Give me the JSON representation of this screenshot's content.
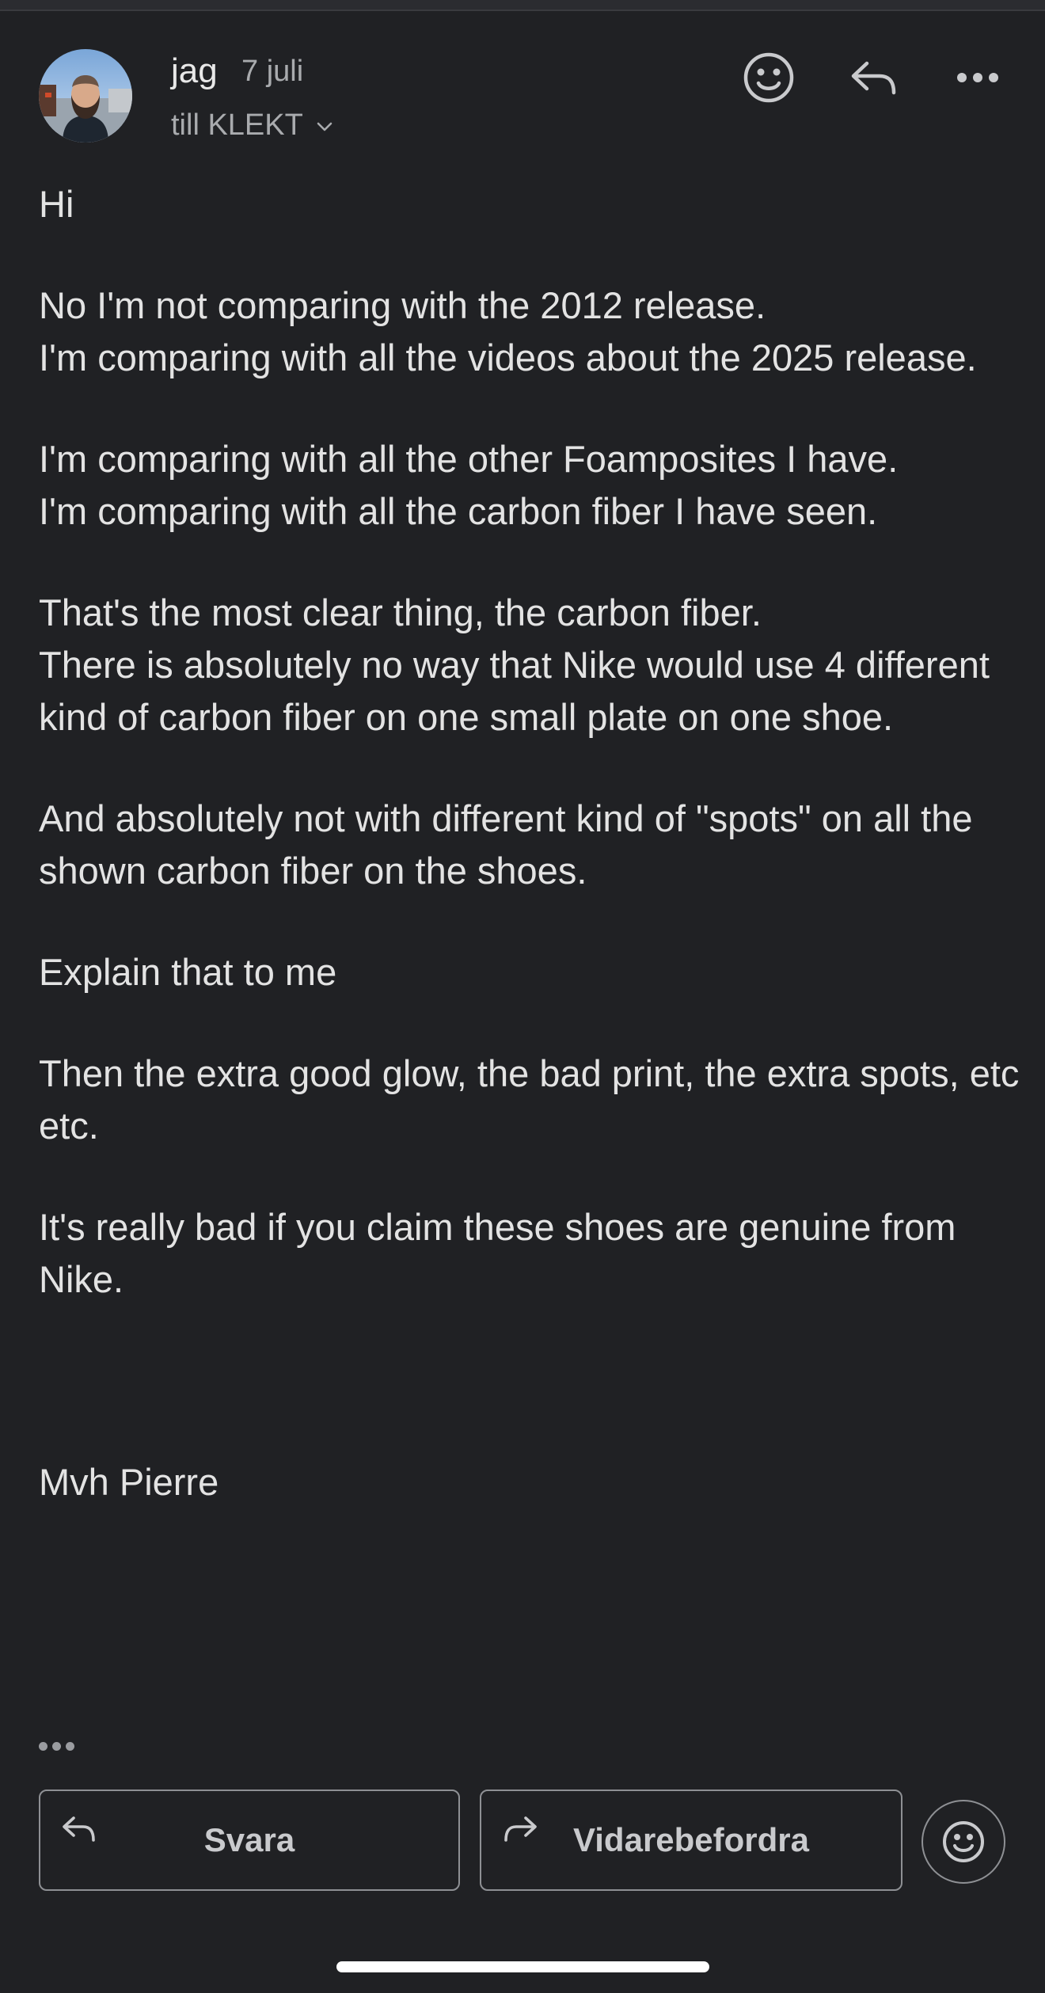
{
  "header": {
    "sender_name": "jag",
    "date": "7 juli",
    "recipient": "till KLEKT",
    "icons": {
      "emoji": "emoji-smile-icon",
      "reply": "reply-icon",
      "more": "more-horizontal-icon"
    }
  },
  "message": {
    "paragraphs": [
      "Hi",
      "No I'm not comparing with the 2012 release.\nI'm comparing with all the videos about the 2025 release.",
      "I'm comparing with all the other Foamposites I have.\nI'm comparing with all the carbon fiber I have seen.",
      "That's the most clear thing, the carbon fiber.\nThere is absolutely no way that Nike would use 4 different kind of carbon fiber on one small plate on one shoe.",
      "And absolutely not with different kind of \"spots\" on all the shown carbon fiber on the shoes.",
      "Explain that to me",
      "Then the extra good glow, the bad print, the extra spots, etc etc.",
      "It's really bad if you claim these shoes are genuine from Nike.",
      "Mvh Pierre"
    ]
  },
  "actions": {
    "reply_label": "Svara",
    "forward_label": "Vidarebefordra"
  },
  "colors": {
    "background": "#202124",
    "text": "#e3e3e3",
    "secondary_text": "#a9abae",
    "border": "#8e9094"
  }
}
